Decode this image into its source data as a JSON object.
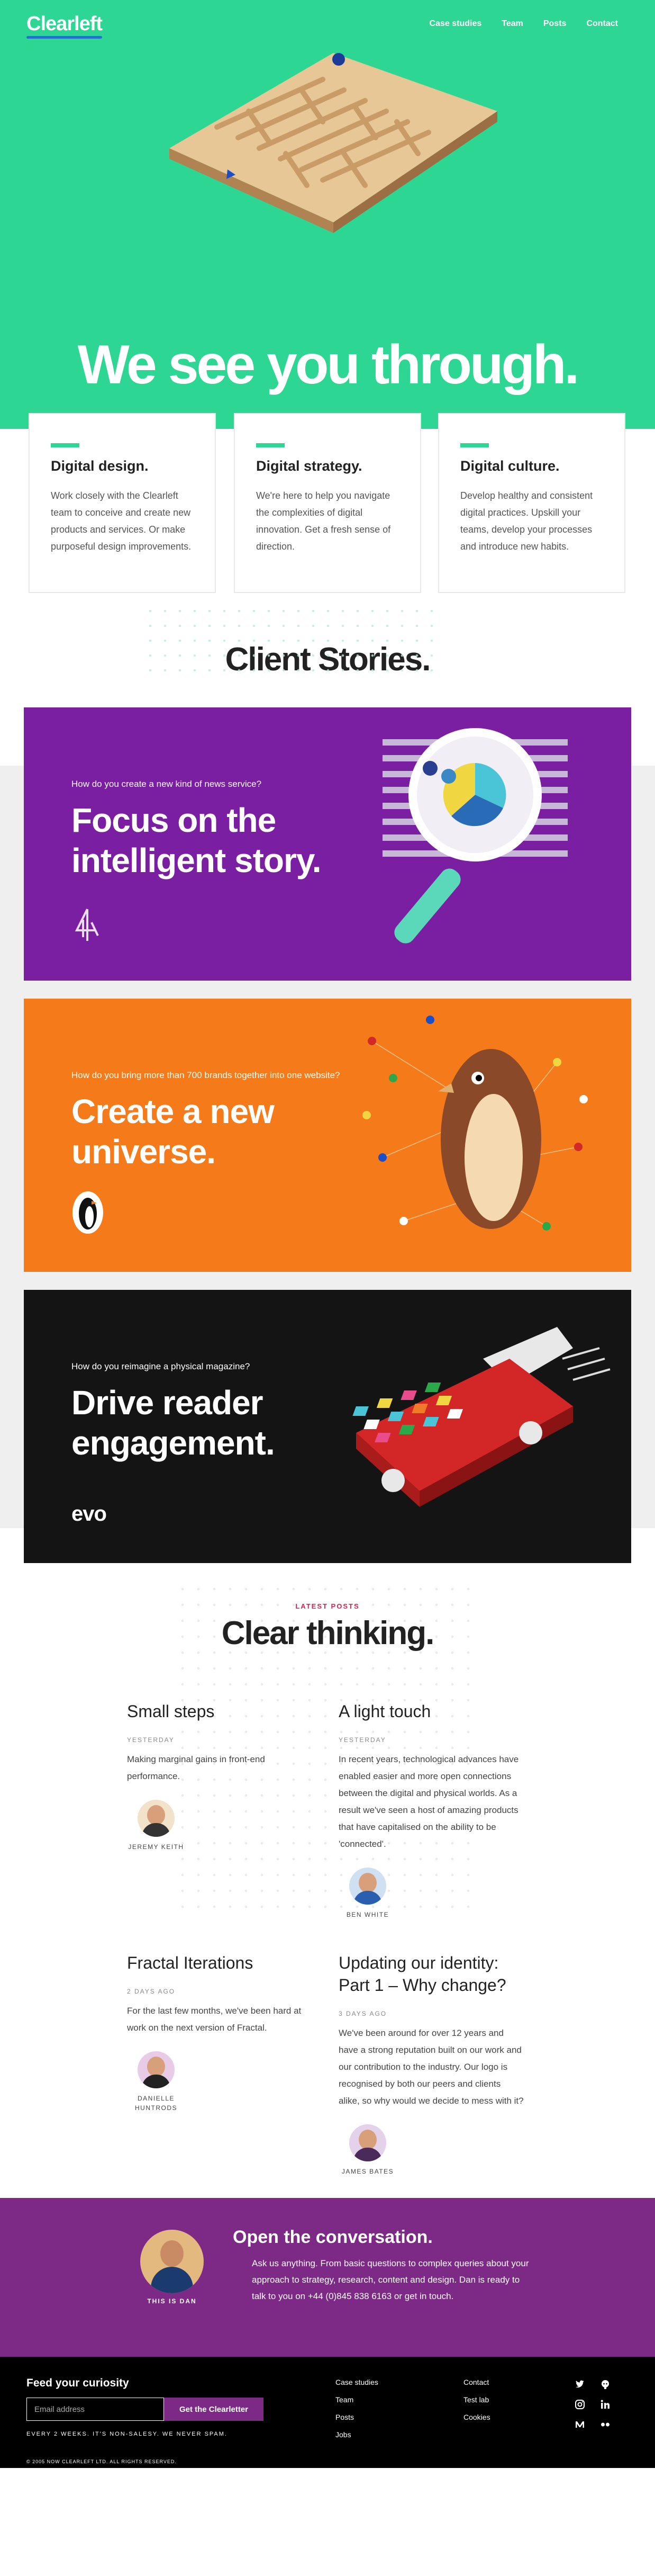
{
  "brand": {
    "logo": "Clearleft"
  },
  "nav": [
    "Case studies",
    "Team",
    "Posts",
    "Contact"
  ],
  "hero": {
    "title": "We see you through."
  },
  "services": [
    {
      "title": "Digital design.",
      "text": "Work closely with the Clearleft team to conceive and create new products and services. Or make purposeful design improvements."
    },
    {
      "title": "Digital strategy.",
      "text": "We're here to help you navigate the complexities of digital innovation. Get a fresh sense of direction."
    },
    {
      "title": "Digital culture.",
      "text": "Develop healthy and consistent digital practices. Upskill your teams, develop your processes and introduce new habits."
    }
  ],
  "stories": {
    "heading": "Client Stories.",
    "items": [
      {
        "question": "How do you create a new kind of news service?",
        "title": "Focus on the intelligent story.",
        "brand": "4",
        "color": "#7b1fa2"
      },
      {
        "question": "How do you bring more than 700 brands together into one website?",
        "title": "Create a new universe.",
        "brand": "penguin",
        "color": "#f47a1a"
      },
      {
        "question": "How do you reimagine a physical magazine?",
        "title": "Drive reader engagement.",
        "brand": "evo",
        "color": "#141414"
      }
    ]
  },
  "blog": {
    "label": "LATEST POSTS",
    "heading": "Clear thinking.",
    "posts": [
      {
        "title": "Small steps",
        "when": "YESTERDAY",
        "summary": "Making marginal gains in front-end performance.",
        "author": "JEREMY KEITH"
      },
      {
        "title": "A light touch",
        "when": "YESTERDAY",
        "summary": "In recent years, technological advances have enabled easier and more open connections between the digital and physical worlds. As a result we've seen a host of amazing products that have capitalised on the ability to be 'connected'.",
        "author": "BEN WHITE"
      },
      {
        "title": "Fractal Iterations",
        "when": "2 DAYS AGO",
        "summary": "For the last few months, we've been hard at work on the next version of Fractal.",
        "author": "DANIELLE HUNTRODS"
      },
      {
        "title": "Updating our identity: Part 1 – Why change?",
        "when": "3 DAYS AGO",
        "summary": "We've been around for over 12 years and have a strong reputation built on our work and our contribution to the industry. Our logo is recognised by both our peers and clients alike, so why would we decide to mess with it?",
        "author": "JAMES BATES"
      }
    ]
  },
  "contact": {
    "person": "THIS IS DAN",
    "heading": "Open the conversation.",
    "text": "Ask us anything. From basic questions to complex queries about your approach to strategy, research, content and design. Dan is ready to talk to you on +44 (0)845 838 6163 or get in touch."
  },
  "footer": {
    "heading": "Feed your curiosity",
    "email_placeholder": "Email address",
    "subscribe": "Get the Clearletter",
    "note": "EVERY 2 WEEKS. IT'S NON-SALESY. WE NEVER SPAM.",
    "col1": [
      "Case studies",
      "Team",
      "Posts",
      "Jobs"
    ],
    "col2": [
      "Contact",
      "Test lab",
      "Cookies"
    ],
    "social": [
      "twitter-icon",
      "github-icon",
      "instagram-icon",
      "linkedin-icon",
      "medium-icon",
      "flickr-icon"
    ],
    "copyright": "© 2005 NOW CLEARLEFT LTD. ALL RIGHTS RESERVED."
  }
}
